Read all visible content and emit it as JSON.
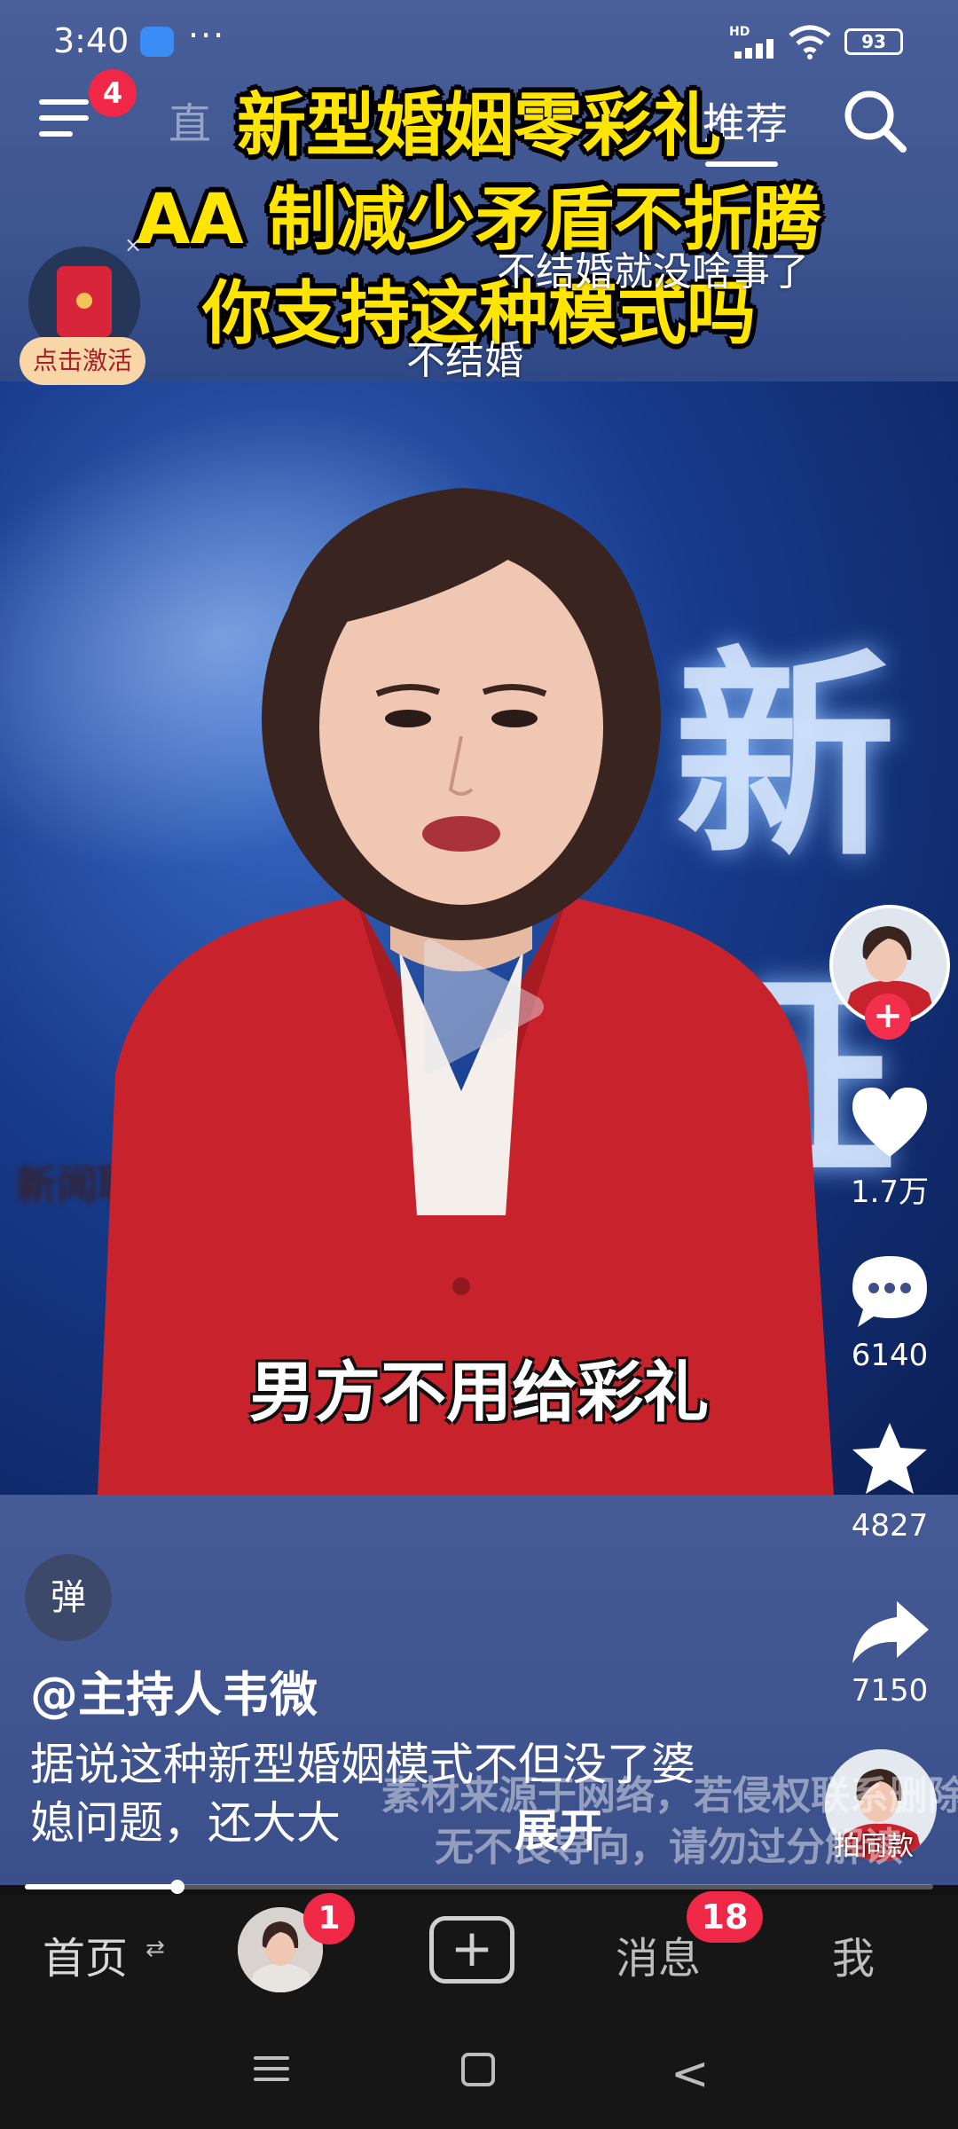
{
  "status_bar": {
    "time": "3:40",
    "more": "···",
    "network": "HD",
    "battery": "93"
  },
  "top_nav": {
    "menu_badge": "4",
    "faded_tab": "直",
    "active_tab": "推荐"
  },
  "headline": {
    "line1": "新型婚姻零彩礼",
    "line2": "AA 制减少矛盾不折腾",
    "line3": "你支持这种模式吗"
  },
  "danmaku": [
    "不结婚就没啥事了",
    "不结婚"
  ],
  "red_envelope": {
    "label": "点击激活",
    "close": "×"
  },
  "video": {
    "subtitle": "男方不用给彩礼",
    "backdrop_text": "新证",
    "blurred_logo": "新闻联播"
  },
  "right_rail": {
    "follow": "+",
    "likes": "1.7万",
    "comments": "6140",
    "favorites": "4827",
    "shares": "7150",
    "same_style": "拍同款"
  },
  "post": {
    "danmaku_toggle": "弹",
    "author": "@主持人韦微",
    "description": "据说这种新型婚姻模式不但没了婆媳问题，还大大",
    "expand": "展开",
    "watermark_line1": "素材来源于网络，若侵权联系删除",
    "watermark_line2": "无不良导向，请勿过分解读"
  },
  "progress": {
    "fraction": 0.168
  },
  "bottom_nav": {
    "home": "首页",
    "home_arrow": "⇄",
    "friend_badge": "1",
    "add": "+",
    "messages": "消息",
    "messages_badge": "18",
    "me": "我"
  },
  "colors": {
    "accent_red": "#f02848",
    "headline_yellow": "#ffe500",
    "nav_background": "#161616"
  },
  "icons": {
    "menu": "menu-icon",
    "search": "search-icon",
    "like": "heart-icon",
    "comment": "comment-icon",
    "favorite": "star-icon",
    "share": "share-arrow-icon",
    "play": "play-icon"
  }
}
